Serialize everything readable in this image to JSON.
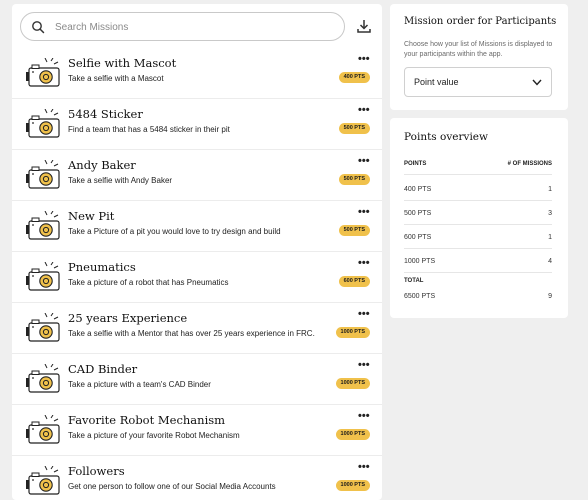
{
  "search": {
    "placeholder": "Search Missions"
  },
  "missions": [
    {
      "title": "Selfie with Mascot",
      "description": "Take a selfie with a Mascot",
      "points": "400 PTS"
    },
    {
      "title": "5484 Sticker",
      "description": "Find a team that has a 5484 sticker in their pit",
      "points": "500 PTS"
    },
    {
      "title": "Andy Baker",
      "description": "Take a selfie with Andy Baker",
      "points": "500 PTS"
    },
    {
      "title": "New Pit",
      "description": "Take a Picture of a pit you would love to try design and build",
      "points": "500 PTS"
    },
    {
      "title": "Pneumatics",
      "description": "Take a picture of a robot that has Pneumatics",
      "points": "600 PTS"
    },
    {
      "title": "25 years Experience",
      "description": "Take a selfie with a Mentor that has over 25 years experience in FRC.",
      "points": "1000 PTS"
    },
    {
      "title": "CAD Binder",
      "description": "Take a picture with a team's CAD Binder",
      "points": "1000 PTS"
    },
    {
      "title": "Favorite Robot Mechanism",
      "description": "Take a picture of your favorite Robot Mechanism",
      "points": "1000 PTS"
    },
    {
      "title": "Followers",
      "description": "Get one person to follow one of our Social Media Accounts",
      "points": "1000 PTS"
    }
  ],
  "more_label": "•••",
  "order": {
    "title": "Mission order for Participants",
    "description": "Choose how your list of Missions is displayed to your participants within the app.",
    "selected": "Point value"
  },
  "overview": {
    "title": "Points overview",
    "col_points": "POINTS",
    "col_missions": "# OF MISSIONS",
    "rows": [
      {
        "points": "400 PTS",
        "count": "1"
      },
      {
        "points": "500 PTS",
        "count": "3"
      },
      {
        "points": "600 PTS",
        "count": "1"
      },
      {
        "points": "1000 PTS",
        "count": "4"
      }
    ],
    "total_label": "TOTAL",
    "total_points": "6500 PTS",
    "total_count": "9"
  },
  "colors": {
    "accent": "#f0c14b",
    "background": "#efefef"
  },
  "icons": {
    "search": "search-icon",
    "download": "download-icon",
    "mission": "camera-icon",
    "dropdown": "chevron-down-icon"
  }
}
